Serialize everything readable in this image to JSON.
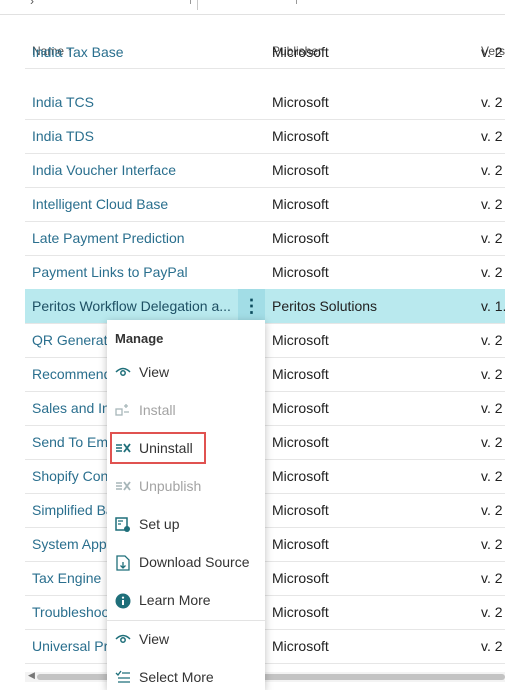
{
  "columns": {
    "name": "Name",
    "name_sort": "↑",
    "publisher": "Publisher",
    "version": "Versi"
  },
  "rows": [
    {
      "name": "India Tax Base",
      "publisher": "Microsoft",
      "version": "v. 2"
    },
    {
      "name": "India TCS",
      "publisher": "Microsoft",
      "version": "v. 2"
    },
    {
      "name": "India TDS",
      "publisher": "Microsoft",
      "version": "v. 2"
    },
    {
      "name": "India Voucher Interface",
      "publisher": "Microsoft",
      "version": "v. 2"
    },
    {
      "name": "Intelligent Cloud Base",
      "publisher": "Microsoft",
      "version": "v. 2"
    },
    {
      "name": "Late Payment Prediction",
      "publisher": "Microsoft",
      "version": "v. 2"
    },
    {
      "name": "Payment Links to PayPal",
      "publisher": "Microsoft",
      "version": "v. 2"
    },
    {
      "name": "Peritos Workflow Delegation a...",
      "publisher": "Peritos Solutions",
      "version": "v. 1."
    },
    {
      "name": "QR Generator",
      "publisher": "Microsoft",
      "version": "v. 2"
    },
    {
      "name": "Recommendations",
      "publisher": "Microsoft",
      "version": "v. 2"
    },
    {
      "name": "Sales and Inventory",
      "publisher": "Microsoft",
      "version": "v. 2"
    },
    {
      "name": "Send To Email",
      "publisher": "Microsoft",
      "version": "v. 2"
    },
    {
      "name": "Shopify Connector",
      "publisher": "Microsoft",
      "version": "v. 2"
    },
    {
      "name": "Simplified Bank",
      "publisher": "Microsoft",
      "version": "v. 2"
    },
    {
      "name": "System Application",
      "publisher": "Microsoft",
      "version": "v. 2"
    },
    {
      "name": "Tax Engine",
      "publisher": "Microsoft",
      "version": "v. 2"
    },
    {
      "name": "Troubleshooting",
      "publisher": "Microsoft",
      "version": "v. 2"
    },
    {
      "name": "Universal Print",
      "publisher": "Microsoft",
      "version": "v. 2"
    }
  ],
  "kebab": "⋮",
  "context_menu": {
    "title": "Manage",
    "items": [
      {
        "label": "View",
        "icon": "eye-icon",
        "glyph": "👁",
        "enabled": true
      },
      {
        "label": "Install",
        "icon": "install-icon",
        "glyph": "⇉",
        "enabled": false
      },
      {
        "label": "Uninstall",
        "icon": "uninstall-icon",
        "glyph": "⇥",
        "enabled": true
      },
      {
        "label": "Unpublish",
        "icon": "unpublish-icon",
        "glyph": "⇥",
        "enabled": false
      },
      {
        "label": "Set up",
        "icon": "setup-icon",
        "glyph": "▦",
        "enabled": true
      },
      {
        "label": "Download Source",
        "icon": "download-source-icon",
        "glyph": "🗎",
        "enabled": true
      },
      {
        "label": "Learn More",
        "icon": "info-icon",
        "glyph": "ℹ",
        "enabled": true
      },
      {
        "label": "View",
        "icon": "eye-icon",
        "glyph": "👁",
        "enabled": true
      },
      {
        "label": "Select More",
        "icon": "select-more-icon",
        "glyph": "☰",
        "enabled": true
      }
    ]
  },
  "colors": {
    "selected_row": "#b9e9ee",
    "link": "#2a6f8e",
    "highlight_box": "#e05250",
    "icon": "#1f6f7a"
  }
}
